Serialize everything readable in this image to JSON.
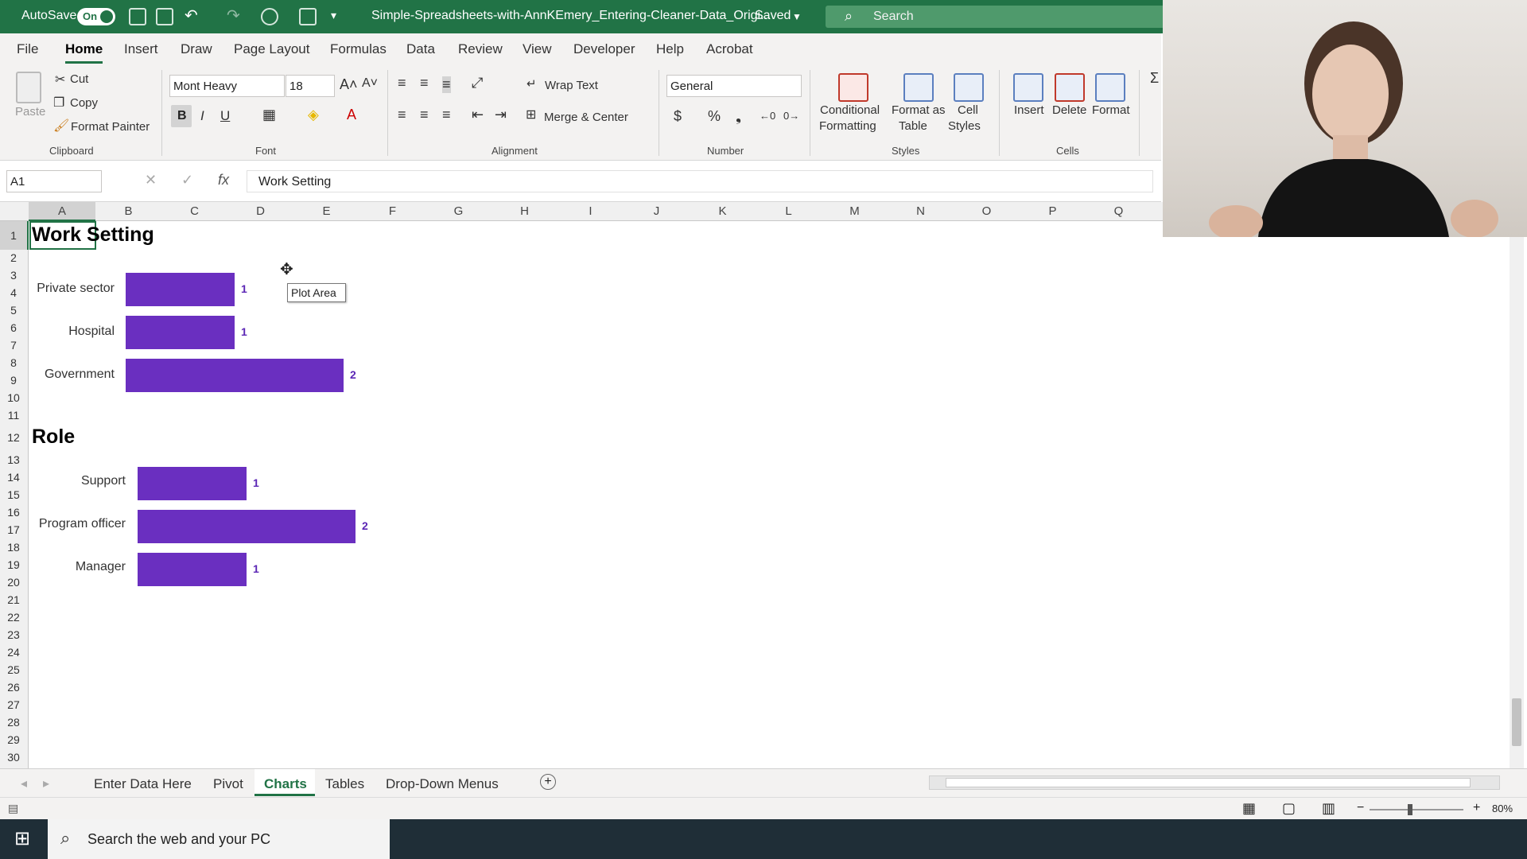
{
  "titlebar": {
    "autosave_label": "AutoSave",
    "autosave_state": "On",
    "filename": "Simple-Spreadsheets-with-AnnKEmery_Entering-Cleaner-Data_Origi...",
    "saved": "Saved",
    "search": "Search",
    "accent": "#217346"
  },
  "tabs": [
    "File",
    "Home",
    "Insert",
    "Draw",
    "Page Layout",
    "Formulas",
    "Data",
    "Review",
    "View",
    "Developer",
    "Help",
    "Acrobat"
  ],
  "ribbon": {
    "clipboard": {
      "paste": "Paste",
      "cut": "Cut",
      "copy": "Copy",
      "format_painter": "Format Painter",
      "group": "Clipboard"
    },
    "font": {
      "name": "Mont Heavy",
      "size": "18",
      "bold": "B",
      "italic": "I",
      "underline": "U",
      "group": "Font"
    },
    "alignment": {
      "wrap": "Wrap Text",
      "merge": "Merge & Center",
      "group": "Alignment"
    },
    "number": {
      "format": "General",
      "group": "Number"
    },
    "styles": {
      "conditional": "Conditional",
      "conditional2": "Formatting",
      "format_table": "Format as",
      "format_table2": "Table",
      "cell_styles": "Cell",
      "cell_styles2": "Styles",
      "group": "Styles"
    },
    "cells": {
      "insert": "Insert",
      "delete": "Delete",
      "format": "Format",
      "group": "Cells"
    }
  },
  "formula_bar": {
    "name_box": "A1",
    "fx": "fx",
    "content": "Work Setting"
  },
  "columns": [
    "A",
    "B",
    "C",
    "D",
    "E",
    "F",
    "G",
    "H",
    "I",
    "J",
    "K",
    "L",
    "M",
    "N",
    "O",
    "P",
    "Q"
  ],
  "rows": [
    "1",
    "2",
    "3",
    "4",
    "5",
    "6",
    "7",
    "8",
    "9",
    "10",
    "11",
    "12",
    "13",
    "14",
    "15",
    "16",
    "17",
    "18",
    "19",
    "20",
    "21",
    "22",
    "23",
    "24",
    "25",
    "26",
    "27",
    "28",
    "29",
    "30"
  ],
  "chart_data": [
    {
      "type": "bar",
      "title": "Work Setting",
      "categories": [
        "Private sector",
        "Hospital",
        "Government"
      ],
      "values": [
        1,
        1,
        2
      ],
      "color": "#6a2fc0"
    },
    {
      "type": "bar",
      "title": "Role",
      "categories": [
        "Support",
        "Program officer",
        "Manager"
      ],
      "values": [
        1,
        2,
        1
      ],
      "color": "#6a2fc0"
    }
  ],
  "tooltip": "Plot Area",
  "sheets": [
    "Enter Data Here",
    "Pivot",
    "Charts",
    "Tables",
    "Drop-Down Menus"
  ],
  "active_sheet": "Charts",
  "zoom": "80%",
  "taskbar": {
    "search": "Search the web and your PC"
  }
}
